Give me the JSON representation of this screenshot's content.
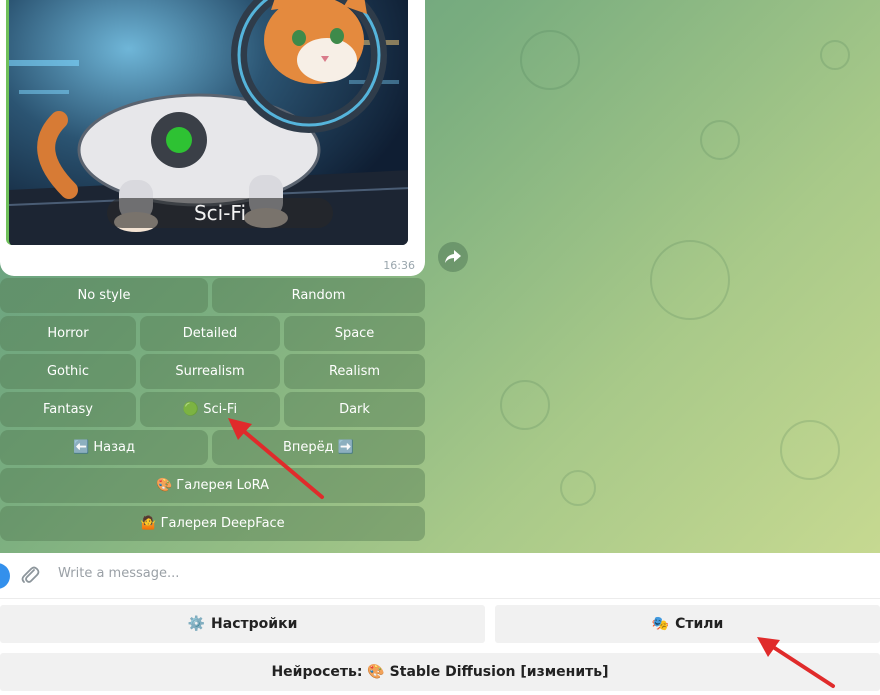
{
  "message": {
    "photo_caption": "Sci-Fi",
    "time": "16:36"
  },
  "inline_keyboard": {
    "rows": [
      [
        {
          "label": "No style"
        },
        {
          "label": "Random"
        }
      ],
      [
        {
          "label": "Horror"
        },
        {
          "label": "Detailed"
        },
        {
          "label": "Space"
        }
      ],
      [
        {
          "label": "Gothic"
        },
        {
          "label": "Surrealism"
        },
        {
          "label": "Realism"
        }
      ],
      [
        {
          "label": "Fantasy"
        },
        {
          "label": "🟢 Sci-Fi"
        },
        {
          "label": "Dark"
        }
      ],
      [
        {
          "label": "⬅️ Назад"
        },
        {
          "label": "Вперёд ➡️"
        }
      ],
      [
        {
          "label": "🎨 Галерея LoRA"
        }
      ],
      [
        {
          "label": "🤷 Галерея DeepFace"
        }
      ]
    ]
  },
  "input": {
    "placeholder": "Write a message..."
  },
  "reply_keyboard": {
    "settings": {
      "emoji": "⚙️",
      "label": "Настройки"
    },
    "styles": {
      "emoji": "🎭",
      "label": "Стили"
    },
    "network": {
      "label": "Нейросеть: 🎨 Stable Diffusion [изменить]"
    }
  },
  "colors": {
    "accent": "#3390ec",
    "arrow": "#e02b2b",
    "selected_dot": "#2ec233"
  }
}
